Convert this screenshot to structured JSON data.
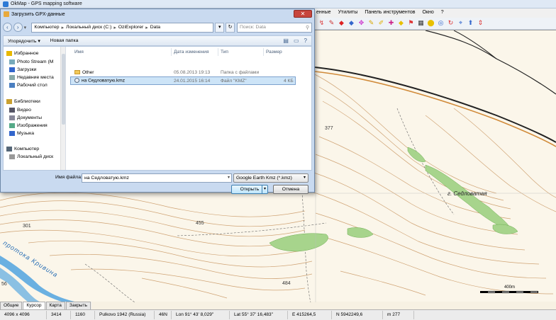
{
  "app": {
    "title": "OkMap - GPS mapping software",
    "menu_visible": [
      "енные",
      "Утилиты",
      "Панель инструментов",
      "Окно",
      "?"
    ]
  },
  "toolbar_icons": [
    {
      "name": "route-icon",
      "glyph": "↯",
      "color": "#d44"
    },
    {
      "name": "track-icon",
      "glyph": "✎",
      "color": "#c33"
    },
    {
      "name": "waypoint-red-icon",
      "glyph": "◆",
      "color": "#d22"
    },
    {
      "name": "waypoint-blue-icon",
      "glyph": "◆",
      "color": "#36c"
    },
    {
      "name": "move-icon",
      "glyph": "✥",
      "color": "#c3c"
    },
    {
      "name": "edit-icon",
      "glyph": "✎",
      "color": "#d8a800"
    },
    {
      "name": "pencil-icon",
      "glyph": "✐",
      "color": "#e0b000"
    },
    {
      "name": "tag-icon",
      "glyph": "✚",
      "color": "#c28"
    },
    {
      "name": "tag-yellow-icon",
      "glyph": "◆",
      "color": "#e8c000"
    },
    {
      "name": "flag-icon",
      "glyph": "⚑",
      "color": "#d33"
    },
    {
      "name": "grid-icon",
      "glyph": "▦",
      "color": "#333"
    },
    {
      "name": "marker-icon",
      "glyph": "⬤",
      "color": "#e8c000"
    },
    {
      "name": "compass-icon",
      "glyph": "◎",
      "color": "#36c"
    },
    {
      "name": "rotate-icon",
      "glyph": "↻",
      "color": "#d33"
    },
    {
      "name": "pin-icon",
      "glyph": "⌖",
      "color": "#36c"
    },
    {
      "name": "up-icon",
      "glyph": "⬆",
      "color": "#36c"
    },
    {
      "name": "down-icon",
      "glyph": "⇕",
      "color": "#d33"
    }
  ],
  "dialog": {
    "title": "Загрузить GPX-данные",
    "close_glyph": "✕",
    "back_glyph": "‹",
    "forward_glyph": "›",
    "dropdown_glyph": "▾",
    "breadcrumb": [
      "Компьютер",
      "Локальный диск (C:)",
      "OziExplorer",
      "Data"
    ],
    "breadcrumb_sep": "▸",
    "refresh_glyph": "↻",
    "search_placeholder": "Поиск: Data",
    "search_glyph": "⚲",
    "organize_label": "Упорядочить ▾",
    "new_folder_label": "Новая папка",
    "view_glyph": "▤",
    "preview_glyph": "▭",
    "help_glyph": "?",
    "nav": [
      {
        "label": "Избранное",
        "icon": "star-icon",
        "color": "#e8b800"
      },
      {
        "label": "Photo Stream (M",
        "icon": "photo-stream-icon",
        "color": "#7ab"
      },
      {
        "label": "Загрузки",
        "icon": "downloads-icon",
        "color": "#36c"
      },
      {
        "label": "Недавние места",
        "icon": "recent-places-icon",
        "color": "#8aa"
      },
      {
        "label": "Рабочий стол",
        "icon": "desktop-icon",
        "color": "#4a7fc1"
      },
      {
        "label": "Библиотеки",
        "icon": "libraries-icon",
        "color": "#c9a030"
      },
      {
        "label": "Видео",
        "icon": "video-icon",
        "color": "#556"
      },
      {
        "label": "Документы",
        "icon": "documents-icon",
        "color": "#889"
      },
      {
        "label": "Изображения",
        "icon": "pictures-icon",
        "color": "#5a8"
      },
      {
        "label": "Музыка",
        "icon": "music-icon",
        "color": "#36c"
      },
      {
        "label": "Компьютер",
        "icon": "computer-icon",
        "color": "#567"
      },
      {
        "label": "Локальный диск",
        "icon": "disk-icon",
        "color": "#999"
      }
    ],
    "columns": {
      "name": "Имя",
      "date": "Дата изменения",
      "type": "Тип",
      "size": "Размер"
    },
    "files": [
      {
        "name": "Other",
        "date": "05.08.2013 19:13",
        "type": "Папка с файлами",
        "size": "",
        "kind": "folder"
      },
      {
        "name": "на Седловатую.kmz",
        "date": "24.01.2015 16:14",
        "type": "Файл \"KMZ\"",
        "size": "4 КБ",
        "kind": "kmz"
      }
    ],
    "filename_label": "Имя файла:",
    "filename_value": "на Седловатую.kmz",
    "filetype_value": "Google Earth Kmz (*.kmz)",
    "open_label": "Открыть",
    "cancel_label": "Отмена"
  },
  "map": {
    "labels": [
      "377",
      "455",
      "301",
      "484",
      "56"
    ],
    "place_name": "г. Седловатая",
    "river_name": "протока Кривина",
    "scale_label": "400m"
  },
  "bottom_tabs": [
    "Общие",
    "Курсор",
    "Карта",
    "Закрыть"
  ],
  "status": [
    "4096 x 4096",
    "3414",
    "1160",
    "Pulkovo 1942 (Russia)",
    "46N",
    "Lon 91° 43' 8,029\"",
    "Lat 55° 37' 16,483\"",
    "E 415264,5",
    "N 5942249,6",
    "m 277"
  ]
}
